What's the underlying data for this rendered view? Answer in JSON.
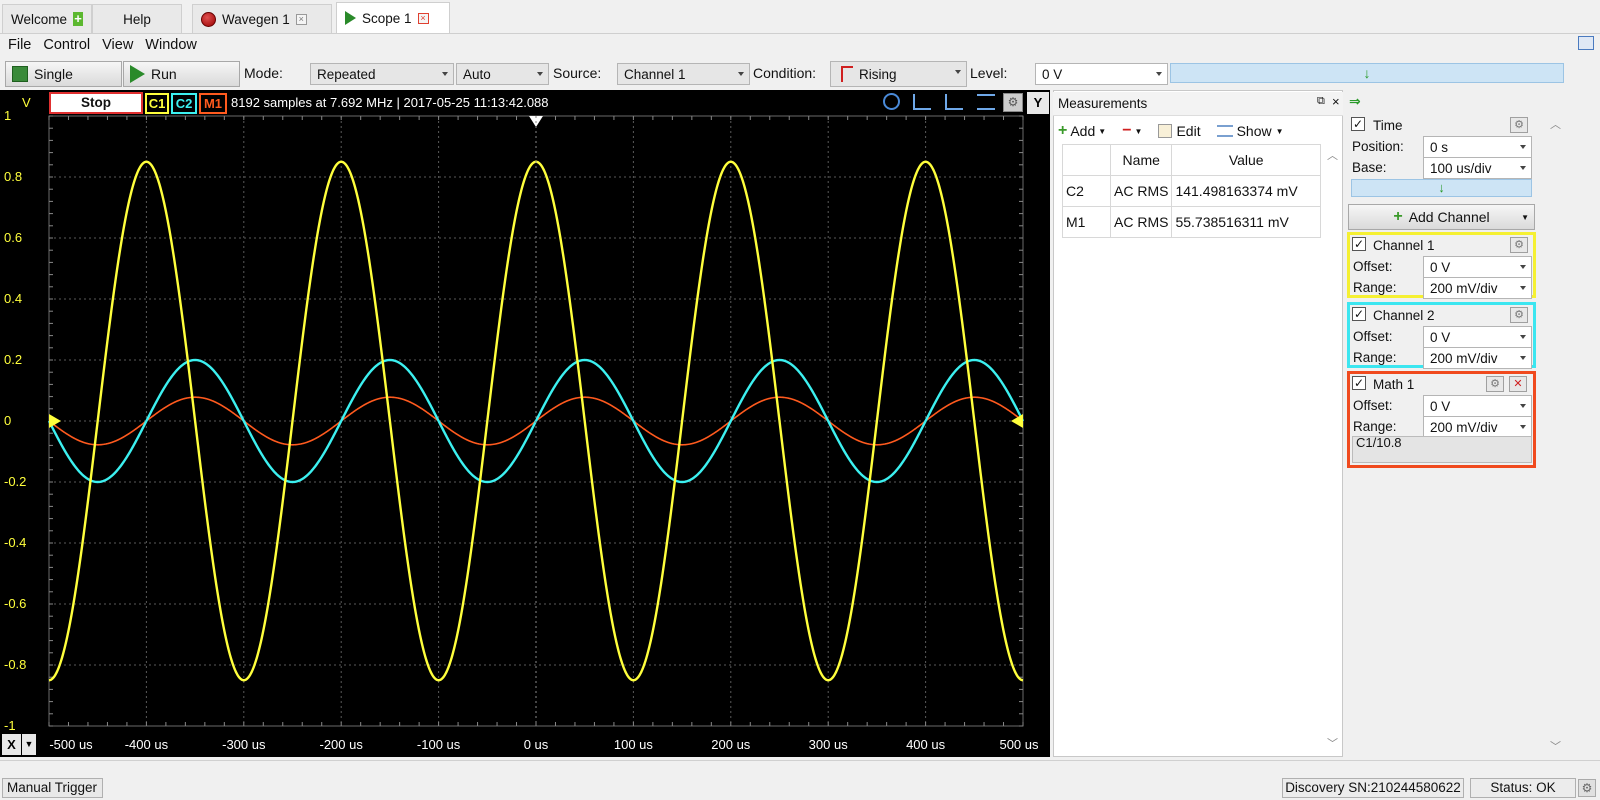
{
  "tabs": [
    {
      "label": "Welcome",
      "icon": "plus-icon"
    },
    {
      "label": "Help"
    },
    {
      "label": "Wavegen 1",
      "icon": "record-icon"
    },
    {
      "label": "Scope 1",
      "icon": "play-icon"
    }
  ],
  "menu": [
    "File",
    "Control",
    "View",
    "Window"
  ],
  "toolbar": {
    "single_label": "Single",
    "run_label": "Run",
    "mode_label": "Mode:",
    "mode_value": "Repeated",
    "auto_value": "Auto",
    "source_label": "Source:",
    "source_value": "Channel 1",
    "condition_label": "Condition:",
    "condition_value": "Rising",
    "level_label": "Level:",
    "level_value": "0 V"
  },
  "scope": {
    "y_unit": "V",
    "stop_label": "Stop",
    "ch_tags": [
      "C1",
      "C2",
      "M1"
    ],
    "info": "8192 samples at 7.692 MHz | 2017-05-25 11:13:42.088",
    "y_button": "Y",
    "x_button": "X",
    "y_ticks": [
      "1",
      "0.8",
      "0.6",
      "0.4",
      "0.2",
      "0",
      "-0.2",
      "-0.4",
      "-0.6",
      "-0.8",
      "-1"
    ],
    "x_ticks": [
      "-500 us",
      "-400 us",
      "-300 us",
      "-200 us",
      "-100 us",
      "0 us",
      "100 us",
      "200 us",
      "300 us",
      "400 us",
      "500 us"
    ],
    "colors": {
      "c1": "#ffff3c",
      "c2": "#3cf0f0",
      "m1": "#ff5a1e",
      "bg": "#000000",
      "grid": "#5a5a5a"
    },
    "traces": [
      {
        "name": "C1",
        "amplitude": 0.85,
        "period_us": 200,
        "phase_deg": 90
      },
      {
        "name": "C2",
        "amplitude": 0.2,
        "period_us": 200,
        "phase_deg": 0
      },
      {
        "name": "M1",
        "amplitude": 0.078,
        "period_us": 200,
        "phase_deg": 0
      }
    ]
  },
  "measurements": {
    "title": "Measurements",
    "add_label": "Add",
    "edit_label": "Edit",
    "show_label": "Show",
    "headers": [
      "",
      "Name",
      "Value"
    ],
    "rows": [
      [
        "C2",
        "AC RMS",
        "141.498163374 mV"
      ],
      [
        "M1",
        "AC RMS",
        "55.738516311 mV"
      ]
    ]
  },
  "time": {
    "title": "Time",
    "position_label": "Position:",
    "position_value": "0 s",
    "base_label": "Base:",
    "base_value": "100 us/div"
  },
  "add_channel_label": "Add Channel",
  "channels": [
    {
      "title": "Channel 1",
      "offset_label": "Offset:",
      "offset": "0 V",
      "range_label": "Range:",
      "range": "200 mV/div"
    },
    {
      "title": "Channel 2",
      "offset_label": "Offset:",
      "offset": "0 V",
      "range_label": "Range:",
      "range": "200 mV/div"
    },
    {
      "title": "Math 1",
      "offset_label": "Offset:",
      "offset": "0 V",
      "range_label": "Range:",
      "range": "200 mV/div",
      "formula": "C1/10.8"
    }
  ],
  "status": {
    "trigger": "Manual Trigger",
    "device": "Discovery SN:210244580622",
    "state": "Status: OK"
  }
}
